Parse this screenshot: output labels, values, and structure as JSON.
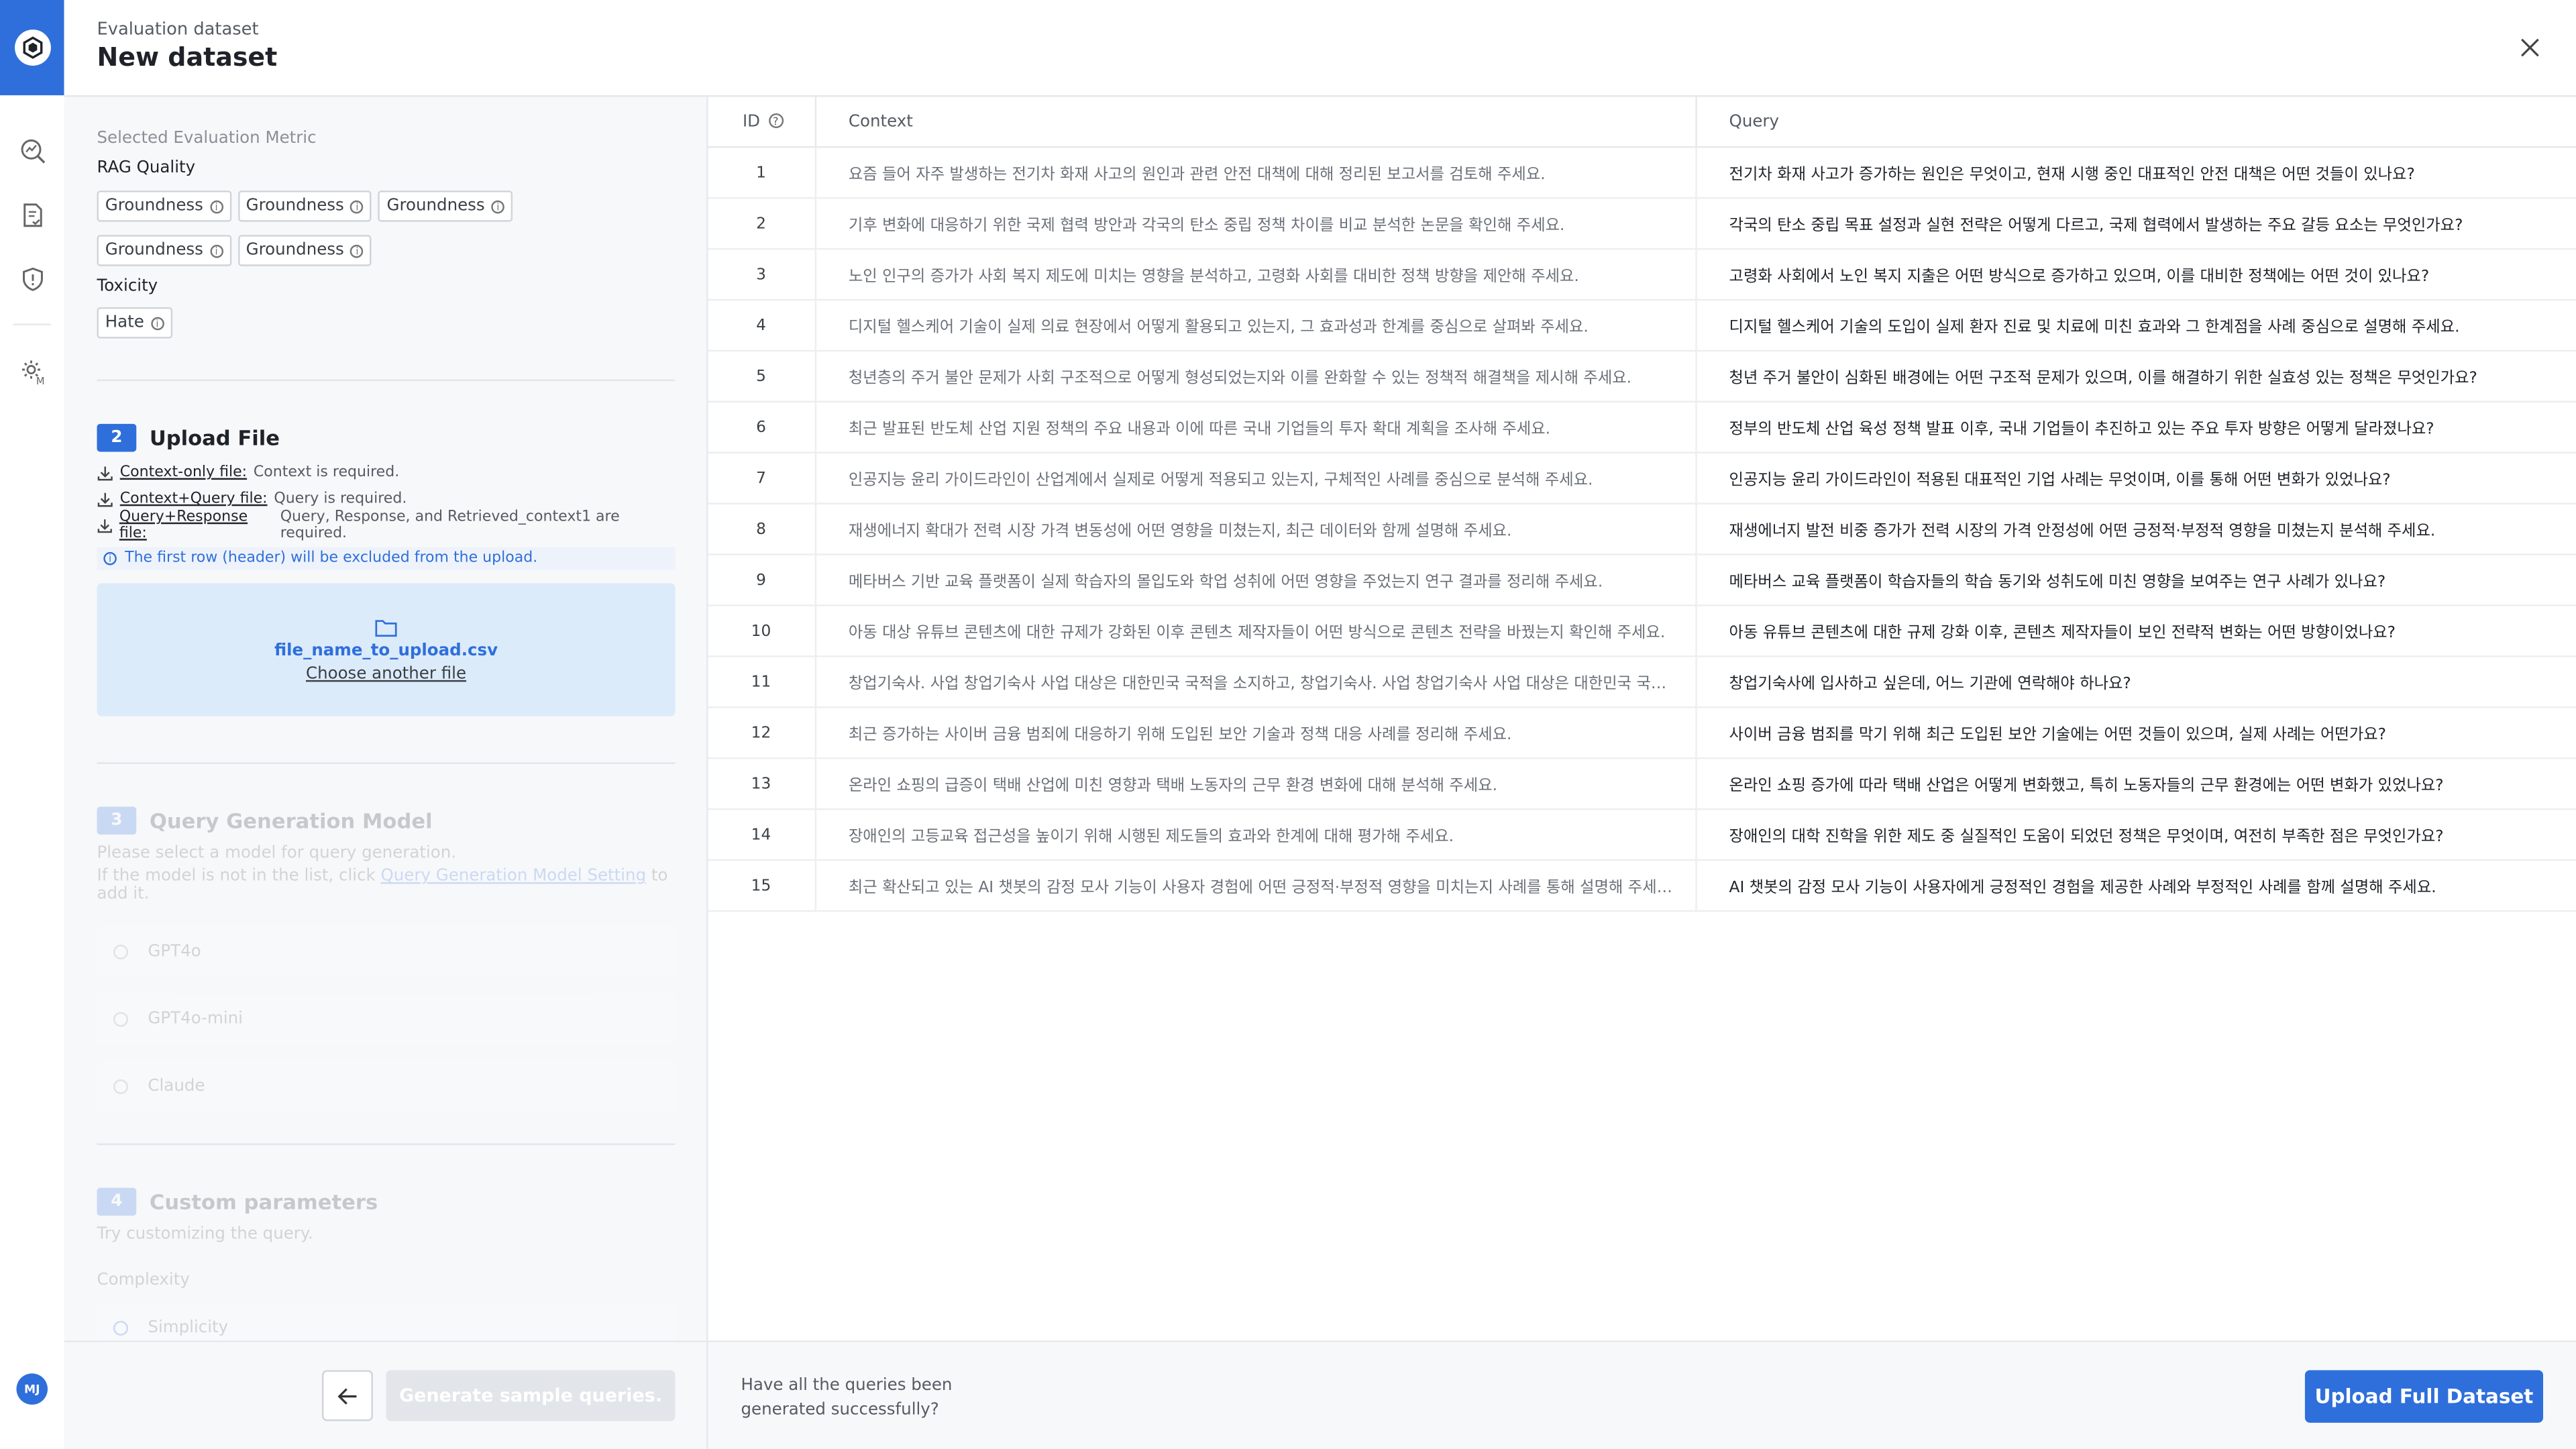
{
  "header": {
    "subtitle": "Evaluation dataset",
    "title": "New dataset"
  },
  "user": {
    "initials": "MJ"
  },
  "metrics": {
    "section_label": "Selected Evaluation Metric",
    "rag_label": "RAG Quality",
    "rag_chips": [
      "Groundness",
      "Groundness",
      "Groundness",
      "Groundness",
      "Groundness"
    ],
    "toxicity_label": "Toxicity",
    "toxicity_chips": [
      "Hate"
    ]
  },
  "upload": {
    "step": "2",
    "title": "Upload File",
    "requirements": [
      {
        "link": "Context-only file:",
        "desc": "Context is required."
      },
      {
        "link": "Context+Query file:",
        "desc": "Query is required."
      },
      {
        "link": "Query+Response file:",
        "desc": "Query, Response, and Retrieved_context1 are required."
      }
    ],
    "note": "The first row (header) will be excluded from the upload.",
    "file_name": "file_name_to_upload.csv",
    "choose_label": "Choose another file"
  },
  "query_model": {
    "step": "3",
    "title": "Query Generation Model",
    "desc1": "Please select a model for query generation.",
    "desc2_pre": "If the model is not in the list, click ",
    "desc2_link": "Query Generation Model Setting",
    "desc2_post": " to add it.",
    "options": [
      "GPT4o",
      "GPT4o-mini",
      "Claude"
    ]
  },
  "custom": {
    "step": "4",
    "title": "Custom parameters",
    "desc": "Try customizing the query.",
    "complexity_label": "Complexity",
    "option": "Simplicity"
  },
  "left_footer": {
    "generate_label": "Generate sample queries."
  },
  "table": {
    "headers": {
      "id": "ID",
      "context": "Context",
      "query": "Query"
    },
    "rows": [
      {
        "id": "1",
        "context": "요즘 들어 자주 발생하는 전기차 화재 사고의 원인과 관련 안전 대책에 대해 정리된 보고서를 검토해 주세요.",
        "query": "전기차 화재 사고가 증가하는 원인은 무엇이고, 현재 시행 중인 대표적인 안전 대책은 어떤 것들이 있나요?"
      },
      {
        "id": "2",
        "context": "기후 변화에 대응하기 위한 국제 협력 방안과 각국의 탄소 중립 정책 차이를 비교 분석한 논문을 확인해 주세요.",
        "query": "각국의 탄소 중립 목표 설정과 실현 전략은 어떻게 다르고, 국제 협력에서 발생하는 주요 갈등 요소는 무엇인가요?"
      },
      {
        "id": "3",
        "context": "노인 인구의 증가가 사회 복지 제도에 미치는 영향을 분석하고, 고령화 사회를 대비한 정책 방향을 제안해 주세요.",
        "query": "고령화 사회에서 노인 복지 지출은 어떤 방식으로 증가하고 있으며, 이를 대비한 정책에는 어떤 것이 있나요?"
      },
      {
        "id": "4",
        "context": "디지털 헬스케어 기술이 실제 의료 현장에서 어떻게 활용되고 있는지, 그 효과성과 한계를 중심으로 살펴봐 주세요.",
        "query": "디지털 헬스케어 기술의 도입이 실제 환자 진료 및 치료에 미친 효과와 그 한계점을 사례 중심으로 설명해 주세요."
      },
      {
        "id": "5",
        "context": "청년층의 주거 불안 문제가 사회 구조적으로 어떻게 형성되었는지와 이를 완화할 수 있는 정책적 해결책을 제시해 주세요.",
        "query": "청년 주거 불안이 심화된 배경에는 어떤 구조적 문제가 있으며, 이를 해결하기 위한 실효성 있는 정책은 무엇인가요?"
      },
      {
        "id": "6",
        "context": "최근 발표된 반도체 산업 지원 정책의 주요 내용과 이에 따른 국내 기업들의 투자 확대 계획을 조사해 주세요.",
        "query": "정부의 반도체 산업 육성 정책 발표 이후, 국내 기업들이 추진하고 있는 주요 투자 방향은 어떻게 달라졌나요?"
      },
      {
        "id": "7",
        "context": "인공지능 윤리 가이드라인이 산업계에서 실제로 어떻게 적용되고 있는지, 구체적인 사례를 중심으로 분석해 주세요.",
        "query": "인공지능 윤리 가이드라인이 적용된 대표적인 기업 사례는 무엇이며, 이를 통해 어떤 변화가 있었나요?"
      },
      {
        "id": "8",
        "context": "재생에너지 확대가 전력 시장 가격 변동성에 어떤 영향을 미쳤는지, 최근 데이터와 함께 설명해 주세요.",
        "query": "재생에너지 발전 비중 증가가 전력 시장의 가격 안정성에 어떤 긍정적·부정적 영향을 미쳤는지 분석해 주세요."
      },
      {
        "id": "9",
        "context": "메타버스 기반 교육 플랫폼이 실제 학습자의 몰입도와 학업 성취에 어떤 영향을 주었는지 연구 결과를 정리해 주세요.",
        "query": "메타버스 교육 플랫폼이 학습자들의 학습 동기와 성취도에 미친 영향을 보여주는 연구 사례가 있나요?"
      },
      {
        "id": "10",
        "context": "아동 대상 유튜브 콘텐츠에 대한 규제가 강화된 이후 콘텐츠 제작자들이 어떤 방식으로 콘텐츠 전략을 바꿨는지 확인해 주세요.",
        "query": "아동 유튜브 콘텐츠에 대한 규제 강화 이후, 콘텐츠 제작자들이 보인 전략적 변화는 어떤 방향이었나요?"
      },
      {
        "id": "11",
        "context": "창업기숙사. 사업 창업기숙사 사업 대상은 대한민국 국적을 소지하고, 창업기숙사. 사업 창업기숙사 사업 대상은 대한민국 국적을 소지하고",
        "query": "창업기숙사에 입사하고 싶은데, 어느 기관에 연락해야 하나요?"
      },
      {
        "id": "12",
        "context": "최근 증가하는 사이버 금융 범죄에 대응하기 위해 도입된 보안 기술과 정책 대응 사례를 정리해 주세요.",
        "query": "사이버 금융 범죄를 막기 위해 최근 도입된 보안 기술에는 어떤 것들이 있으며, 실제 사례는 어떤가요?"
      },
      {
        "id": "13",
        "context": "온라인 쇼핑의 급증이 택배 산업에 미친 영향과 택배 노동자의 근무 환경 변화에 대해 분석해 주세요.",
        "query": "온라인 쇼핑 증가에 따라 택배 산업은 어떻게 변화했고, 특히 노동자들의 근무 환경에는 어떤 변화가 있었나요?"
      },
      {
        "id": "14",
        "context": "장애인의 고등교육 접근성을 높이기 위해 시행된 제도들의 효과와 한계에 대해 평가해 주세요.",
        "query": "장애인의 대학 진학을 위한 제도 중 실질적인 도움이 되었던 정책은 무엇이며, 여전히 부족한 점은 무엇인가요?"
      },
      {
        "id": "15",
        "context": "최근 확산되고 있는 AI 챗봇의 감정 모사 기능이 사용자 경험에 어떤 긍정적·부정적 영향을 미치는지 사례를 통해 설명해 주세요.",
        "query": "AI 챗봇의 감정 모사 기능이 사용자에게 긍정적인 경험을 제공한 사례와 부정적인 사례를 함께 설명해 주세요."
      }
    ]
  },
  "right_footer": {
    "question": "Have all the queries been generated successfully?",
    "upload_label": "Upload Full Dataset"
  }
}
